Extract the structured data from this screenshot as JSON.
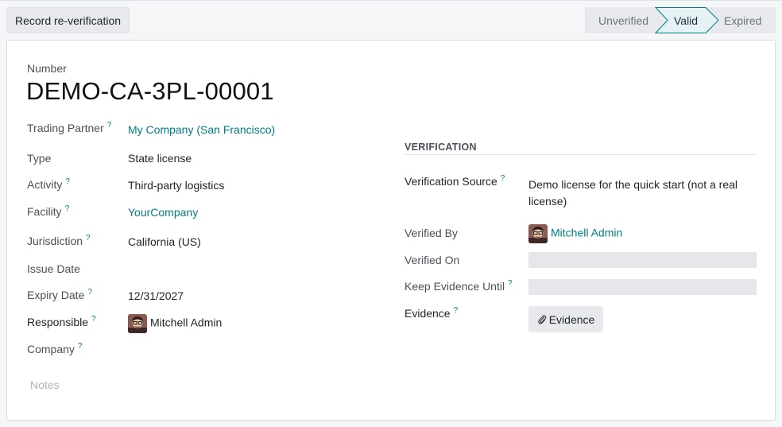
{
  "header": {
    "action_button": "Record re-verification",
    "stages": [
      {
        "label": "Unverified",
        "active": false
      },
      {
        "label": "Valid",
        "active": true
      },
      {
        "label": "Expired",
        "active": false
      }
    ]
  },
  "record": {
    "number_label": "Number",
    "name": "DEMO-CA-3PL-00001"
  },
  "left_fields": {
    "trading_partner": {
      "label": "Trading Partner",
      "value": "My Company (San Francisco)"
    },
    "type": {
      "label": "Type",
      "value": "State license"
    },
    "activity": {
      "label": "Activity",
      "value": "Third-party logistics"
    },
    "facility": {
      "label": "Facility",
      "value": "YourCompany"
    },
    "jurisdiction": {
      "label": "Jurisdiction",
      "value": "California (US)"
    },
    "issue_date": {
      "label": "Issue Date",
      "value": ""
    },
    "expiry_date": {
      "label": "Expiry Date",
      "value": "12/31/2027"
    },
    "responsible": {
      "label": "Responsible",
      "value": "Mitchell Admin"
    },
    "company": {
      "label": "Company",
      "value": ""
    }
  },
  "verification": {
    "title": "VERIFICATION",
    "source": {
      "label": "Verification Source",
      "value_line1": "Demo license for the quick start (not a real",
      "value_line2": "license)"
    },
    "verified_by": {
      "label": "Verified By",
      "value": "Mitchell Admin"
    },
    "verified_on": {
      "label": "Verified On",
      "value": ""
    },
    "keep_until": {
      "label": "Keep Evidence Until",
      "value": ""
    },
    "evidence": {
      "label": "Evidence",
      "button": "Evidence"
    }
  },
  "help_marker": "?",
  "notes_placeholder": "Notes",
  "colors": {
    "link": "#017e84",
    "active_stage_bg": "#e6f2f3",
    "active_stage_border": "#017e84"
  }
}
